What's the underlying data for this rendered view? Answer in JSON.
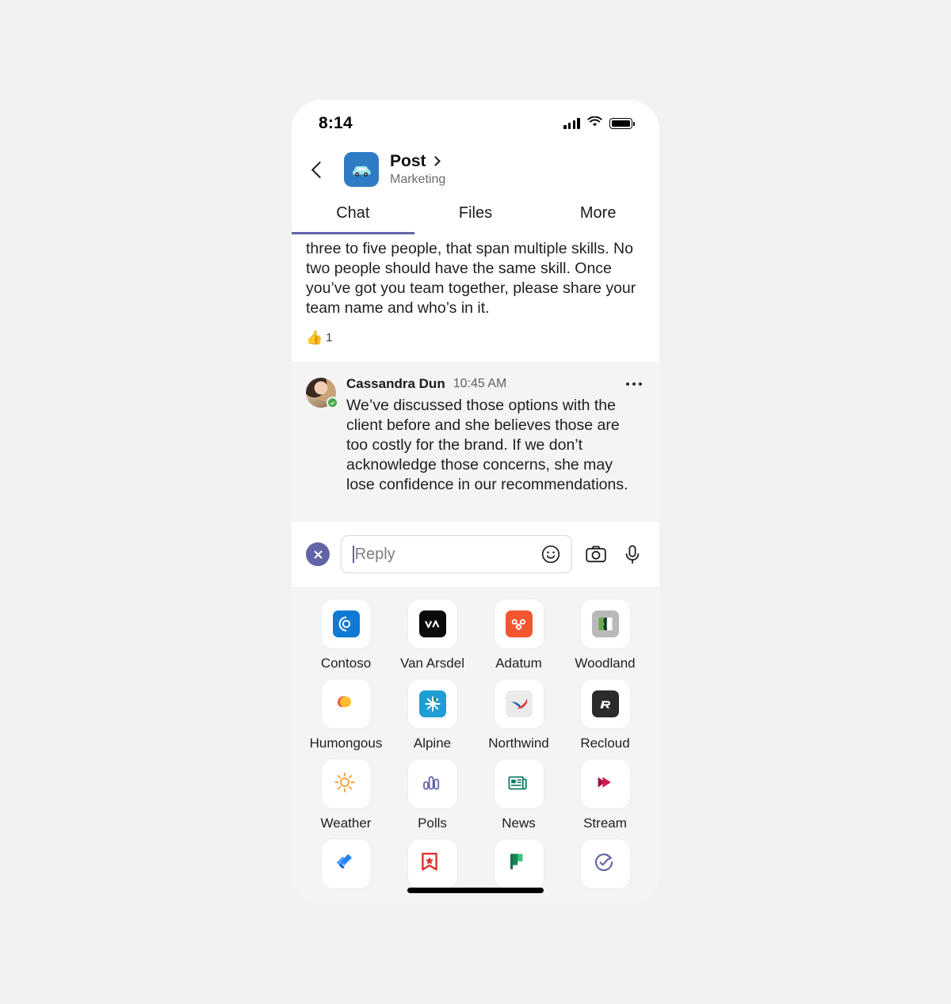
{
  "theme": {
    "accent": "#6264a7",
    "presence_available": "#46ad4a",
    "page_bg": "#f2f2f2",
    "panel_bg": "#f4f4f4"
  },
  "status_bar": {
    "time": "8:14",
    "signal_icon": "cellular-bars-icon",
    "wifi_icon": "wifi-icon",
    "battery_icon": "battery-full-icon"
  },
  "header": {
    "back_icon": "chevron-left-icon",
    "team_icon": "car-app-icon",
    "title": "Post",
    "title_chevron_icon": "chevron-right-icon",
    "subtitle": "Marketing"
  },
  "tabs": {
    "active_index": 0,
    "items": [
      {
        "label": "Chat"
      },
      {
        "label": "Files"
      },
      {
        "label": "More"
      }
    ]
  },
  "messages": [
    {
      "id": "msg-scrolled",
      "body": "three to five people, that span multiple skills. No two people should have the same skill. Once you’ve got you team together, please share your team name and who’s in it.",
      "reaction": {
        "emoji": "👍",
        "icon": "thumbs-up-icon",
        "count": "1"
      }
    },
    {
      "id": "msg-cassandra",
      "sender": "Cassandra Dun",
      "time": "10:45 AM",
      "avatar_icon": "user-avatar",
      "presence_icon": "presence-available-icon",
      "overflow_icon": "more-options-icon",
      "body": "We’ve discussed those options with the client before and she believes those are too costly for the brand. If we don’t acknowledge those concerns, she may lose confidence in our recommendations."
    }
  ],
  "reply_bar": {
    "close_icon": "close-icon",
    "placeholder": "Reply",
    "emoji_icon": "emoji-smiley-icon",
    "camera_icon": "camera-icon",
    "mic_icon": "microphone-icon"
  },
  "app_grid": {
    "rows": [
      [
        {
          "label": "Contoso",
          "icon": "contoso-app-icon"
        },
        {
          "label": "Van Arsdel",
          "icon": "van-arsdel-app-icon"
        },
        {
          "label": "Adatum",
          "icon": "adatum-app-icon"
        },
        {
          "label": "Woodland",
          "icon": "woodland-app-icon"
        }
      ],
      [
        {
          "label": "Humongous",
          "icon": "humongous-app-icon"
        },
        {
          "label": "Alpine",
          "icon": "alpine-app-icon"
        },
        {
          "label": "Northwind",
          "icon": "northwind-app-icon"
        },
        {
          "label": "Recloud",
          "icon": "recloud-app-icon"
        }
      ],
      [
        {
          "label": "Weather",
          "icon": "weather-sun-icon"
        },
        {
          "label": "Polls",
          "icon": "polls-bars-icon"
        },
        {
          "label": "News",
          "icon": "news-paper-icon"
        },
        {
          "label": "Stream",
          "icon": "stream-play-icon"
        }
      ],
      [
        {
          "label": "",
          "icon": "jira-app-icon"
        },
        {
          "label": "",
          "icon": "wunderlist-bookmark-icon"
        },
        {
          "label": "",
          "icon": "planner-flag-icon"
        },
        {
          "label": "",
          "icon": "updates-refresh-check-icon"
        }
      ]
    ]
  },
  "home_indicator": "home-indicator"
}
